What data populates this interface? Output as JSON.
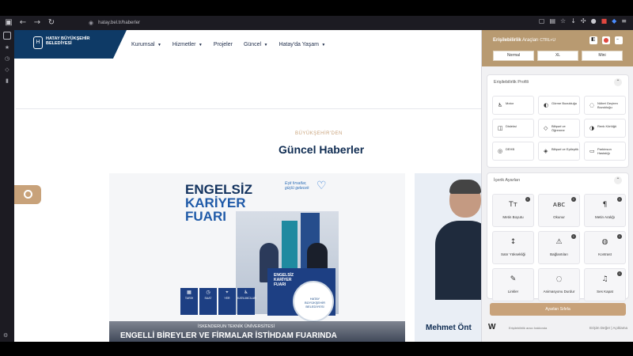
{
  "browser": {
    "url": "hatay.bel.tr/haberler",
    "nav_back": "←",
    "nav_forward": "→",
    "nav_reload": "↻",
    "nav_home": "⌂",
    "lock_icon": "🔒"
  },
  "site": {
    "logo_lines": "HATAY BÜYÜKŞEHİR BELEDİYESİ",
    "nav": [
      {
        "label": "Kurumsal"
      },
      {
        "label": "Hizmetler"
      },
      {
        "label": "Projeler"
      },
      {
        "label": "Güncel"
      },
      {
        "label": "Hatay'da Yaşam"
      }
    ],
    "section_kicker": "BÜYÜKŞEHİR'DEN",
    "section_title": "Güncel Haberler",
    "card1": {
      "poster_line1": "ENGELSİZ",
      "poster_line2": "KARİYER",
      "poster_line3": "FUARI",
      "tagline": "Eşit fırsatlar, güçlü gelecek",
      "desk_text": "ENGELSİZ KARİYER FUARI",
      "badge_text": "HATAY BÜYÜKŞEHİR BELEDİYESİ",
      "tiles": [
        "TARİH",
        "SAAT",
        "YER",
        "KATILIMCILAR"
      ],
      "caption_small": "İSKENDERUN TEKNİK ÜNİVERSİTESİ",
      "caption_main": "ENGELLİ BİREYLER VE FİRMALAR İSTİHDAM FUARINDA"
    },
    "card2": {
      "name": "Mehmet Önt"
    }
  },
  "panel": {
    "title_bold": "Erişilebilirlik",
    "title_rest": "Araçları",
    "shortcut": "CTRL+U",
    "sizes": [
      "Normal",
      "XL",
      "Mini"
    ],
    "section1_title": "Erişilebilirlik Profili",
    "profiles": [
      {
        "icon": "♿",
        "label": "Motor"
      },
      {
        "icon": "◐",
        "label": "Görme Bozukluğu"
      },
      {
        "icon": "◌",
        "label": "Nöbet Geçiren Bozukluğu"
      },
      {
        "icon": "◫",
        "label": "Disleksi"
      },
      {
        "icon": "◇",
        "label": "Bilişsel ve Öğrenme"
      },
      {
        "icon": "◑",
        "label": "Renk Körlüğü"
      },
      {
        "icon": "◎",
        "label": "DEHB"
      },
      {
        "icon": "◈",
        "label": "Bilişsel ve Epileptik"
      },
      {
        "icon": "▭",
        "label": "Parkinson Hastalığı"
      }
    ],
    "section2_title": "İçerik Ayarları",
    "content": [
      {
        "icon": "Tт",
        "label": "Metin Boyutu"
      },
      {
        "icon": "ᴀʙᴄ",
        "label": "Okunur"
      },
      {
        "icon": "¶",
        "label": "Metin Aralığı"
      },
      {
        "icon": "↕",
        "label": "Satır Yüksekliği"
      },
      {
        "icon": "⚠",
        "label": "Bağlantıları"
      },
      {
        "icon": "◍",
        "label": "Kontrast"
      },
      {
        "icon": "✎",
        "label": "Linkler"
      },
      {
        "icon": "◌",
        "label": "Animasyonu Durdur"
      },
      {
        "icon": "♫",
        "label": "Ses Kapat"
      }
    ],
    "reset_label": "Ayarları Sıfırla",
    "footer_text": "Erişilebilirlik aracı hakkında",
    "footer_links": "Erişim Değer  |  Açıklama"
  }
}
